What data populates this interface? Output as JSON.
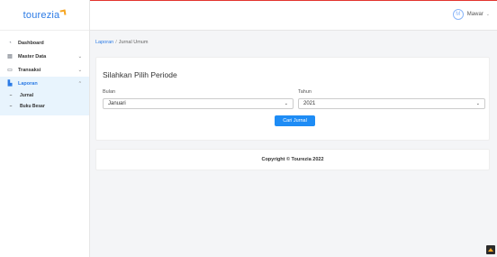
{
  "brand": {
    "name": "tourezia"
  },
  "sidebar": {
    "items": [
      {
        "label": "Dashboard",
        "icon": "dashboard-icon"
      },
      {
        "label": "Master Data",
        "icon": "database-icon"
      },
      {
        "label": "Transaksi",
        "icon": "transaction-icon"
      },
      {
        "label": "Laporan",
        "icon": "report-icon"
      }
    ],
    "sub_items": [
      {
        "label": "Jurnal"
      },
      {
        "label": "Buku Besar"
      }
    ]
  },
  "header": {
    "user_name": "Mawar",
    "avatar_initial": "M"
  },
  "breadcrumb": {
    "parent": "Laporan",
    "separator": "/",
    "current": "Jurnal Umum"
  },
  "form": {
    "title": "Silahkan Pilih Periode",
    "month_label": "Bulan",
    "month_value": "Januari",
    "year_label": "Tahun",
    "year_value": "2021",
    "submit_label": "Cari Jurnal"
  },
  "footer": {
    "text": "Copyright © Tourezia 2022"
  },
  "colors": {
    "accent": "#2c7be5",
    "button": "#1e8cf5",
    "topline": "#e3342f",
    "brand_mark": "#f6a623"
  }
}
